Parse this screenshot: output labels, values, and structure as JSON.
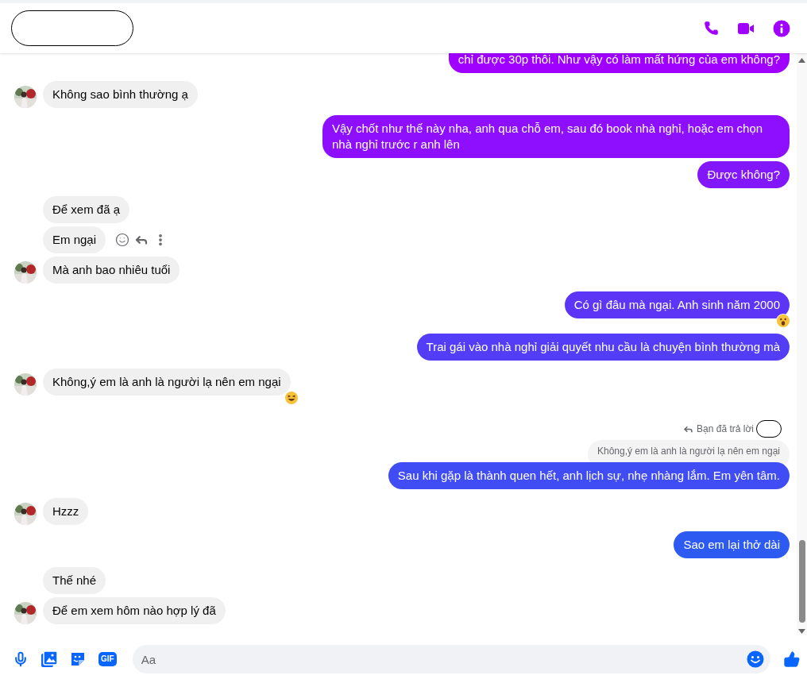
{
  "messages": [
    {
      "kind": "outgoing",
      "text": "chỉ được 30p thôi. Như vậy có làm mất hứng của em không?",
      "clipped": true
    },
    {
      "kind": "incoming",
      "text": "Không sao bình thường ạ",
      "avatar": true
    },
    {
      "kind": "outgoing",
      "text": "Vậy chốt như thế này nha, anh qua chỗ em, sau đó book nhà nghỉ, hoặc em chọn nhà nghỉ trước r anh lên"
    },
    {
      "kind": "outgoing",
      "text": "Được không?"
    },
    {
      "kind": "incoming",
      "text": "Để xem đã ạ",
      "avatar": false
    },
    {
      "kind": "incoming",
      "text": "Em ngại",
      "avatar": false,
      "hovered": true
    },
    {
      "kind": "incoming",
      "text": "Mà anh bao nhiêu tuổi",
      "avatar": true
    },
    {
      "kind": "outgoing",
      "text": "Có gì đâu mà ngại. Anh sinh năm 2000",
      "reaction": {
        "kind": "surprised"
      }
    },
    {
      "kind": "outgoing",
      "text": "Trai gái vào nhà nghỉ giải quyết nhu cầu là chuyện bình thường mà"
    },
    {
      "kind": "incoming",
      "text": "Không,ý em là anh là người lạ nên em ngại",
      "avatar": true,
      "reaction": {
        "kind": "laughing"
      }
    },
    {
      "kind": "outgoing",
      "text": "Sau khi gặp là thành quen hết, anh lịch sự, nhẹ nhàng lắm. Em yên tâm.",
      "reply": {
        "label": "Bạn đã trả lời",
        "quote": "Không,ý em là anh là người lạ nên em ngại"
      }
    },
    {
      "kind": "incoming",
      "text": "Hzzz",
      "avatar": true
    },
    {
      "kind": "outgoing",
      "text": "Sao em lại thở dài"
    },
    {
      "kind": "incoming",
      "text": "Thế nhé",
      "avatar": false
    },
    {
      "kind": "incoming",
      "text": "Để em xem hôm nào hợp lý đã",
      "avatar": true
    }
  ],
  "composer": {
    "gif_label": "GIF",
    "placeholder": "Aa"
  }
}
